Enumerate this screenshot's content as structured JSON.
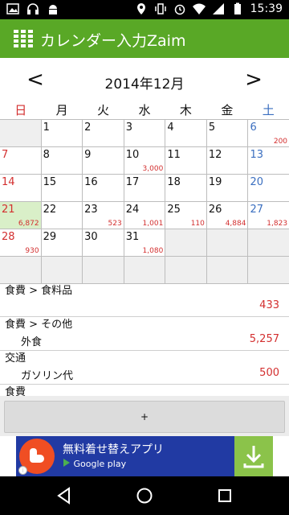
{
  "status": {
    "time": "15:39"
  },
  "app": {
    "title": "カレンダー入力Zaim"
  },
  "calendar": {
    "month": "2014年12月",
    "prev": "<",
    "next": ">",
    "weekdays": [
      "日",
      "月",
      "火",
      "水",
      "木",
      "金",
      "土"
    ],
    "weeks": [
      [
        {
          "d": ""
        },
        {
          "d": "1"
        },
        {
          "d": "2"
        },
        {
          "d": "3"
        },
        {
          "d": "4"
        },
        {
          "d": "5"
        },
        {
          "d": "6",
          "a": "200"
        }
      ],
      [
        {
          "d": "7"
        },
        {
          "d": "8"
        },
        {
          "d": "9"
        },
        {
          "d": "10",
          "a": "3,000"
        },
        {
          "d": "11"
        },
        {
          "d": "12"
        },
        {
          "d": "13"
        }
      ],
      [
        {
          "d": "14"
        },
        {
          "d": "15"
        },
        {
          "d": "16"
        },
        {
          "d": "17"
        },
        {
          "d": "18"
        },
        {
          "d": "19"
        },
        {
          "d": "20"
        }
      ],
      [
        {
          "d": "21",
          "a": "6,872",
          "today": true
        },
        {
          "d": "22"
        },
        {
          "d": "23",
          "a": "523"
        },
        {
          "d": "24",
          "a": "1,001"
        },
        {
          "d": "25",
          "a": "110"
        },
        {
          "d": "26",
          "a": "4,884"
        },
        {
          "d": "27",
          "a": "1,823"
        }
      ],
      [
        {
          "d": "28",
          "a": "930"
        },
        {
          "d": "29"
        },
        {
          "d": "30"
        },
        {
          "d": "31",
          "a": "1,080"
        },
        {
          "d": ""
        },
        {
          "d": ""
        },
        {
          "d": ""
        }
      ],
      [
        {
          "d": ""
        },
        {
          "d": ""
        },
        {
          "d": ""
        },
        {
          "d": ""
        },
        {
          "d": ""
        },
        {
          "d": ""
        },
        {
          "d": ""
        }
      ]
    ]
  },
  "entries": [
    {
      "category": "食費 > 食料品",
      "sub": "",
      "amount": "433"
    },
    {
      "category": "食費 > その他",
      "sub": "外食",
      "amount": "5,257"
    },
    {
      "category": "交通",
      "sub": "ガソリン代",
      "amount": "500"
    },
    {
      "category": "食費",
      "sub": "",
      "amount": ""
    }
  ],
  "add_button": "+",
  "ad": {
    "title": "無料着せ替えアプリ",
    "store": "Google play",
    "info": "i"
  },
  "colors": {
    "appbar": "#59a826",
    "sunday": "#d32f2f",
    "saturday": "#3b6fc0",
    "amount": "#d32f2f",
    "today": "#d9efc8"
  }
}
